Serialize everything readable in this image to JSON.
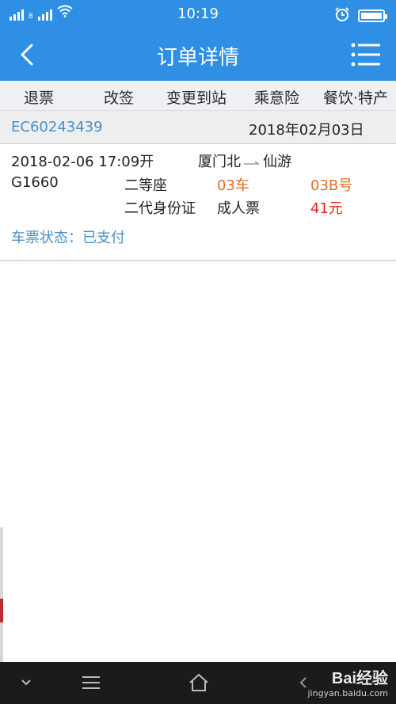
{
  "status_bar": {
    "time": "10:19",
    "sim_label": "8",
    "battery_level": 1.0,
    "icons": [
      "signal-icon",
      "wifi-icon",
      "alarm-clock-icon",
      "battery-icon"
    ]
  },
  "header": {
    "title": "订单详情",
    "back_icon": "chevron-left-icon",
    "menu_icon": "list-menu-icon",
    "background_color": "#2f8fe4"
  },
  "actions": [
    {
      "label": "退票"
    },
    {
      "label": "改签"
    },
    {
      "label": "变更到站"
    },
    {
      "label": "乘意险"
    },
    {
      "label": "餐饮·特产"
    }
  ],
  "order": {
    "number": "EC60243439",
    "date": "2018年02月03日"
  },
  "ticket": {
    "departure": "2018-02-06  17:09开",
    "from_station": "厦门北",
    "to_station": "仙游",
    "train_no": "G1660",
    "seat_class": "二等座",
    "car": "03车",
    "seat": "03B号",
    "id_type": "二代身份证",
    "ticket_type": "成人票",
    "price": "41元",
    "status": "车票状态：已支付"
  },
  "bottom_nav": {
    "icons": [
      "chevron-down-icon",
      "menu-lines-icon",
      "home-icon",
      "back-arrow-icon"
    ]
  },
  "watermark": {
    "brand": "Bai经验",
    "url": "jingyan.baidu.com"
  },
  "colors": {
    "accent": "#2f8fe4",
    "link_blue": "#4a8fc7",
    "orange": "#e0702a",
    "price_red": "#e8231f"
  }
}
